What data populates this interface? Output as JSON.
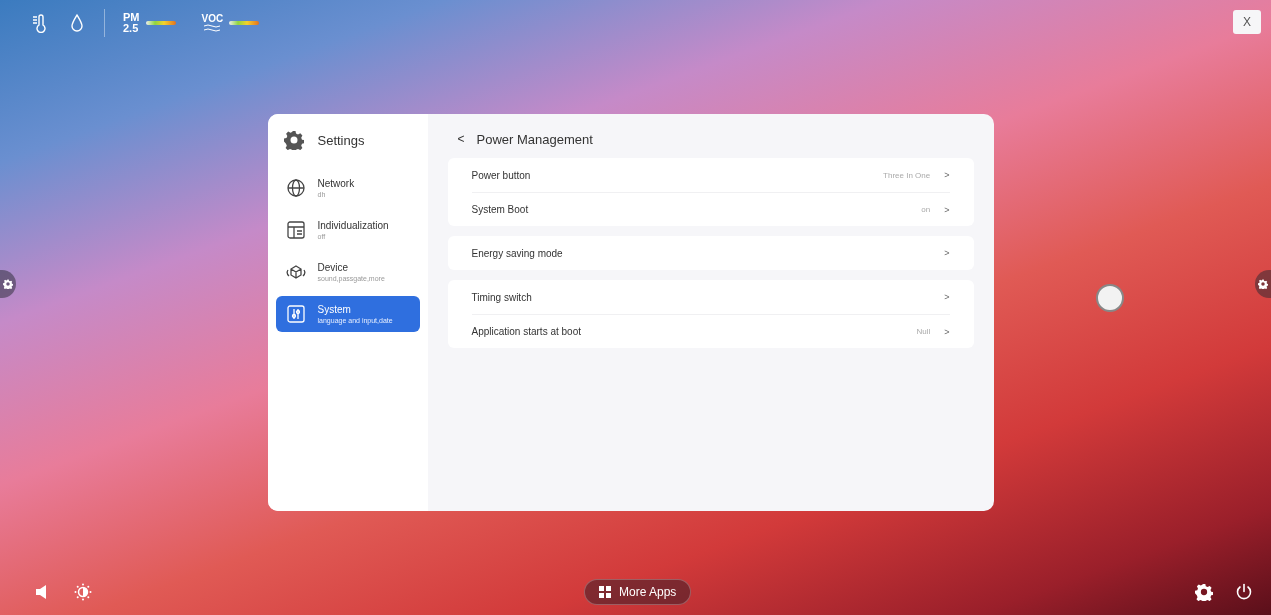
{
  "status_bar": {
    "pm_label": "PM",
    "pm_value": "2.5",
    "voc_label": "VOC"
  },
  "close_button": "X",
  "settings": {
    "title": "Settings",
    "sidebar": [
      {
        "kind": "network",
        "label": "Network",
        "subtitle": "dh",
        "selected": false
      },
      {
        "kind": "individualization",
        "label": "Individualization",
        "subtitle": "off",
        "selected": false
      },
      {
        "kind": "device",
        "label": "Device",
        "subtitle": "sound,passgate,more",
        "selected": false
      },
      {
        "kind": "system",
        "label": "System",
        "subtitle": "language and input,date",
        "selected": true
      }
    ],
    "back": "<",
    "page_title": "Power Management",
    "groups": [
      [
        {
          "label": "Power button",
          "value": "Three In One"
        },
        {
          "label": "System Boot",
          "value": "on"
        }
      ],
      [
        {
          "label": "Energy saving mode"
        }
      ],
      [
        {
          "label": "Timing switch"
        },
        {
          "label": "Application starts at boot",
          "value": "Null"
        }
      ]
    ],
    "chevron": ">"
  },
  "dock": {
    "more_apps": "More Apps"
  }
}
